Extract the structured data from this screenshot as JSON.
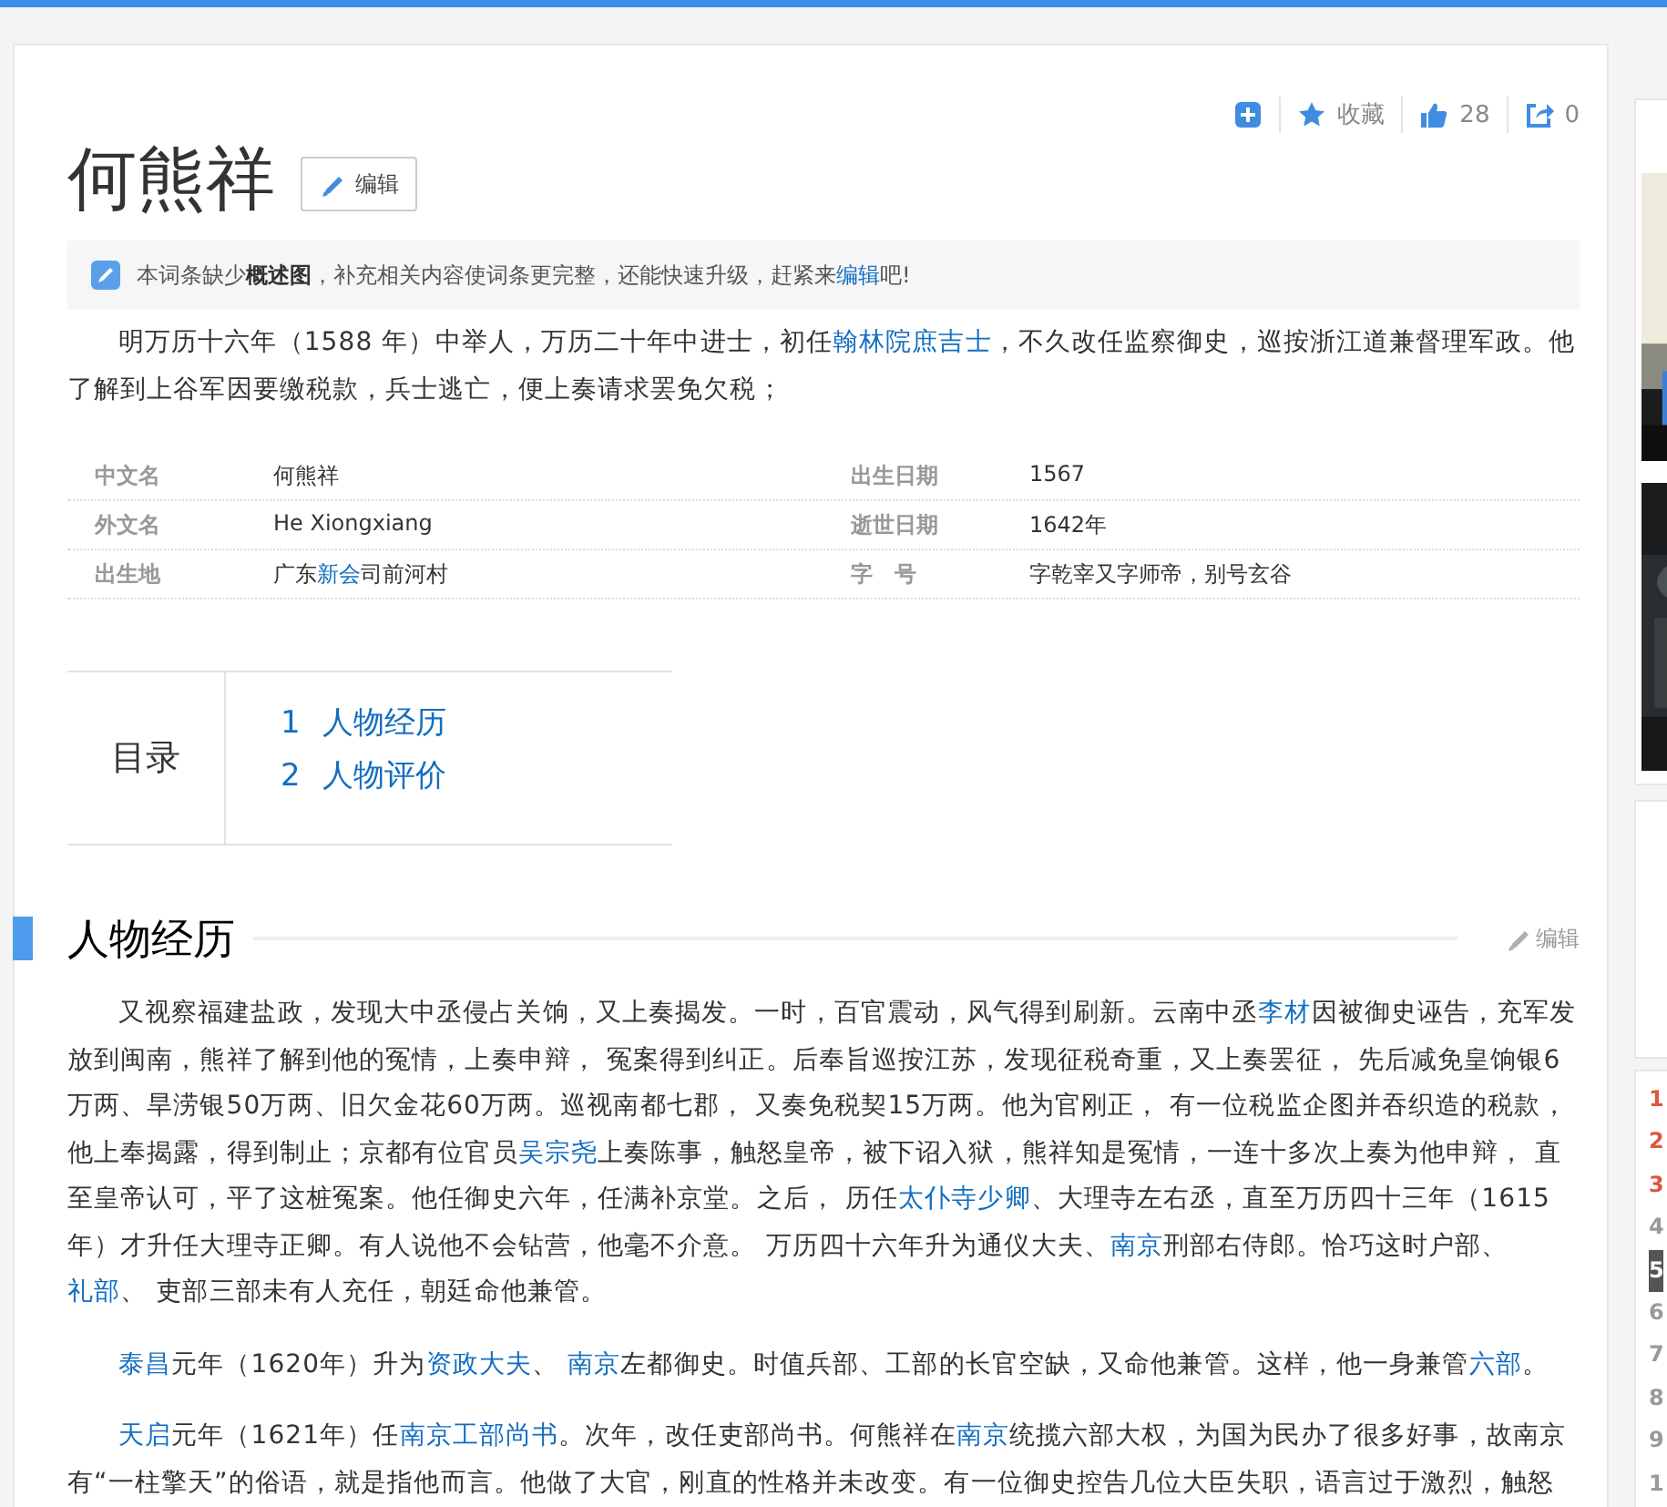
{
  "actions": [
    {
      "kind": "add"
    },
    {
      "kind": "favorite",
      "label": "收藏"
    },
    {
      "kind": "like",
      "label": "28"
    },
    {
      "kind": "share",
      "label": "0"
    }
  ],
  "title": "何熊祥",
  "title_edit": "编辑",
  "notice": [
    {
      "kind": "plain",
      "text": "本词条缺少"
    },
    {
      "kind": "bold",
      "text": "概述图"
    },
    {
      "kind": "plain",
      "text": "，补充相关内容使词条更完整，还能快速升级，赶紧来"
    },
    {
      "kind": "link",
      "text": "编辑"
    },
    {
      "kind": "plain",
      "text": "吧!"
    }
  ],
  "summary": [
    {
      "kind": "plain",
      "text": "明万历十六年（1588 年）中举人，万历二十年中进士，初任"
    },
    {
      "kind": "link",
      "text": "翰林院庶吉士"
    },
    {
      "kind": "plain",
      "text": "，不久改任监察御史，巡按浙江道兼督理军政。他了解到上谷军因要缴税款，兵士逃亡，便上奏请求罢免欠税；"
    }
  ],
  "infobox": [
    {
      "cells": [
        {
          "label": "中文名",
          "value": [
            {
              "kind": "plain",
              "text": "何熊祥"
            }
          ]
        },
        {
          "label": "出生日期",
          "value": [
            {
              "kind": "plain",
              "text": "1567"
            }
          ]
        }
      ]
    },
    {
      "cells": [
        {
          "label": "外文名",
          "value": [
            {
              "kind": "plain",
              "text": "He Xiongxiang"
            }
          ]
        },
        {
          "label": "逝世日期",
          "value": [
            {
              "kind": "plain",
              "text": "1642年"
            }
          ]
        }
      ]
    },
    {
      "cells": [
        {
          "label": "出生地",
          "value": [
            {
              "kind": "plain",
              "text": "广东"
            },
            {
              "kind": "link",
              "text": "新会"
            },
            {
              "kind": "plain",
              "text": "司前河村"
            }
          ]
        },
        {
          "label": "字　号",
          "value": [
            {
              "kind": "plain",
              "text": "字乾宰又字师帝，别号玄谷"
            }
          ]
        }
      ]
    }
  ],
  "toc": {
    "title": "目录",
    "items": [
      {
        "number": "1",
        "label": "人物经历"
      },
      {
        "number": "2",
        "label": "人物评价"
      }
    ]
  },
  "section": {
    "title": "人物经历",
    "edit": "编辑",
    "paragraphs": [
      [
        {
          "kind": "plain",
          "text": "又视察福建盐政，发现大中丞侵占关饷，又上奏揭发。一时，百官震动，风气得到刷新。云南中丞"
        },
        {
          "kind": "link",
          "text": "李材"
        },
        {
          "kind": "plain",
          "text": "因被御史诬告，充军发放到闽南，熊祥了解到他的冤情，上奏申辩， 冤案得到纠正。后奉旨巡按江苏，发现征税奇重，又上奏罢征， 先后减免皇饷银6万两、旱涝银50万两、旧欠金花60万两。巡视南都七郡， 又奏免税契15万两。他为官刚正， 有一位税监企图并吞织造的税款，他上奉揭露，得到制止；京都有位官员"
        },
        {
          "kind": "link",
          "text": "吴宗尧"
        },
        {
          "kind": "plain",
          "text": "上奏陈事，触怒皇帝，被下诏入狱，熊祥知是冤情，一连十多次上奏为他申辩， 直至皇帝认可，平了这桩冤案。他任御史六年，任满补京堂。之后， 历任"
        },
        {
          "kind": "link",
          "text": "太仆寺少卿"
        },
        {
          "kind": "plain",
          "text": "、大理寺左右丞，直至万历四十三年（1615 年）才升任大理寺正卿。有人说他不会钻营，他毫不介意。 万历四十六年升为通仪大夫、"
        },
        {
          "kind": "link",
          "text": "南京"
        },
        {
          "kind": "plain",
          "text": "刑部右侍郎。恰巧这时户部、"
        },
        {
          "kind": "link",
          "text": "礼部"
        },
        {
          "kind": "plain",
          "text": "、 吏部三部未有人充任，朝廷命他兼管。"
        }
      ],
      [
        {
          "kind": "link",
          "text": "泰昌"
        },
        {
          "kind": "plain",
          "text": "元年（1620年）升为"
        },
        {
          "kind": "link",
          "text": "资政大夫"
        },
        {
          "kind": "plain",
          "text": "、 "
        },
        {
          "kind": "link",
          "text": "南京"
        },
        {
          "kind": "plain",
          "text": "左都御史。时值兵部、工部的长官空缺，又命他兼管。这样，他一身兼管"
        },
        {
          "kind": "link",
          "text": "六部"
        },
        {
          "kind": "plain",
          "text": "。"
        }
      ],
      [
        {
          "kind": "link",
          "text": "天启"
        },
        {
          "kind": "plain",
          "text": "元年（1621年）任"
        },
        {
          "kind": "link",
          "text": "南京工部尚书"
        },
        {
          "kind": "plain",
          "text": "。次年，改任吏部尚书。何熊祥在"
        },
        {
          "kind": "link",
          "text": "南京"
        },
        {
          "kind": "plain",
          "text": "统揽六部大权，为国为民办了很多好事，故南京有“一柱擎天”的俗语，就是指他而言。他做了大官，刚直的性格并未改变。有一位御史控告几位大臣失职，语言过于激烈，触怒"
        }
      ]
    ]
  },
  "sidebar": {
    "ranks": [
      {
        "text": "1",
        "kind": "top"
      },
      {
        "text": "2",
        "kind": "top"
      },
      {
        "text": "3",
        "kind": "top"
      },
      {
        "text": "4",
        "kind": "normal"
      },
      {
        "text": "5",
        "kind": "current"
      },
      {
        "text": "6",
        "kind": "normal"
      },
      {
        "text": "7",
        "kind": "normal"
      },
      {
        "text": "8",
        "kind": "normal"
      },
      {
        "text": "9",
        "kind": "normal"
      },
      {
        "text": "1",
        "kind": "normal"
      }
    ]
  }
}
